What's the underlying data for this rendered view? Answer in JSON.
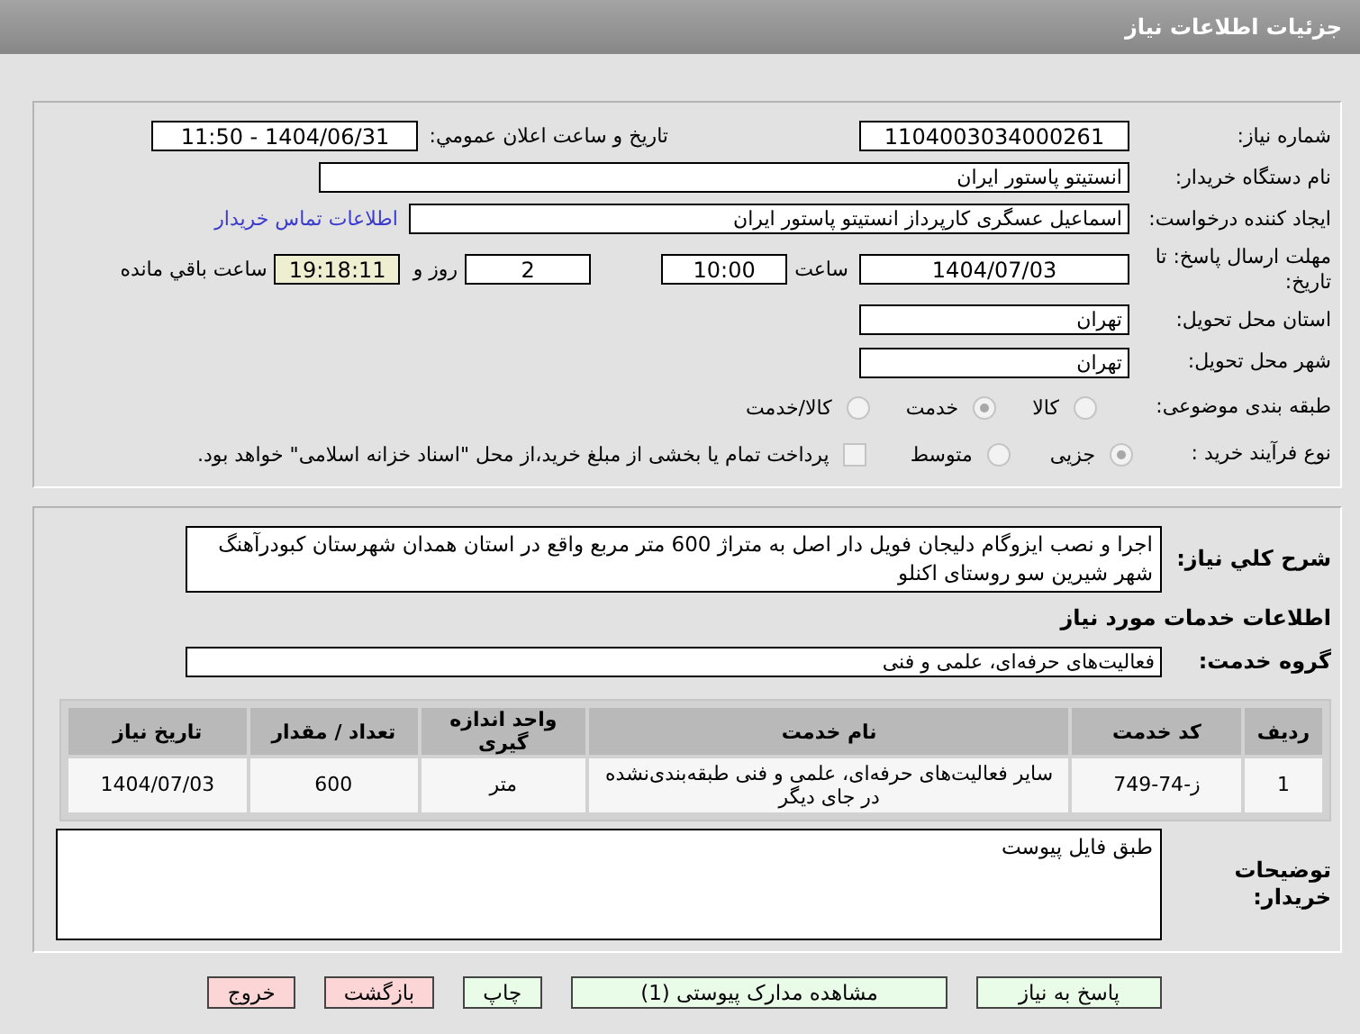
{
  "header": {
    "title": "جزئیات اطلاعات نیاز"
  },
  "details": {
    "need_number": {
      "label": "شماره نیاز:",
      "value": "1104003034000261"
    },
    "announce": {
      "label": "تاریخ و ساعت اعلان عمومي:",
      "value": "1404/06/31 - 11:50"
    },
    "buyer_org": {
      "label": "نام دستگاه خریدار:",
      "value": "انستیتو پاستور ایران"
    },
    "creator": {
      "label": "ایجاد کننده درخواست:",
      "value": "اسماعیل عسگری کارپرداز انستیتو پاستور ایران",
      "link": "اطلاعات تماس خریدار"
    },
    "deadline": {
      "label": "مهلت ارسال پاسخ: تا تاریخ:",
      "date": "1404/07/03",
      "time_label": "ساعت",
      "time": "10:00",
      "days": "2",
      "days_label": "روز و",
      "remaining": "19:18:11",
      "remaining_label": "ساعت باقي مانده"
    },
    "province": {
      "label": "استان محل تحویل:",
      "value": "تهران"
    },
    "city": {
      "label": "شهر محل تحویل:",
      "value": "تهران"
    },
    "category": {
      "label": "طبقه بندی موضوعی:",
      "options": [
        {
          "label": "کالا",
          "selected": false
        },
        {
          "label": "خدمت",
          "selected": true
        },
        {
          "label": "کالا/خدمت",
          "selected": false
        }
      ]
    },
    "process": {
      "label": "نوع فرآیند خرید :",
      "options": [
        {
          "label": "جزیی",
          "selected": true
        },
        {
          "label": "متوسط",
          "selected": false
        }
      ],
      "treasury": {
        "checked": false,
        "text": "پرداخت تمام یا بخشی از مبلغ خرید،از محل \"اسناد خزانه اسلامی\" خواهد بود."
      }
    }
  },
  "description": {
    "label": "شرح کلي نیاز:",
    "value": "اجرا و نصب ایزوگام دلیجان فویل دار اصل به متراژ 600 متر مربع واقع در استان همدان شهرستان کبودرآهنگ شهر شیرین سو روستای اکنلو"
  },
  "services_title": "اطلاعات خدمات مورد نیاز",
  "service_group": {
    "label": "گروه خدمت:",
    "value": "فعالیت‌های حرفه‌ای، علمی و فنی"
  },
  "table": {
    "columns": [
      "ردیف",
      "کد خدمت",
      "نام خدمت",
      "واحد اندازه گیری",
      "تعداد / مقدار",
      "تاریخ نیاز"
    ],
    "rows": [
      [
        "1",
        "ز-74-749",
        "سایر فعالیت‌های حرفه‌ای، علمی و فنی طبقه‌بندی‌نشده در جای دیگر",
        "متر",
        "600",
        "1404/07/03"
      ]
    ]
  },
  "buyer_notes": {
    "label": "توضیحات خریدار:",
    "value": "طبق فایل پیوست"
  },
  "buttons": [
    {
      "label": "پاسخ به نیاز",
      "kind": "action"
    },
    {
      "label": "مشاهده مدارک پیوستی (1)",
      "kind": "action"
    },
    {
      "label": "چاپ",
      "kind": "action"
    },
    {
      "label": "بازگشت",
      "kind": "exit"
    },
    {
      "label": "خروج",
      "kind": "exit"
    }
  ]
}
